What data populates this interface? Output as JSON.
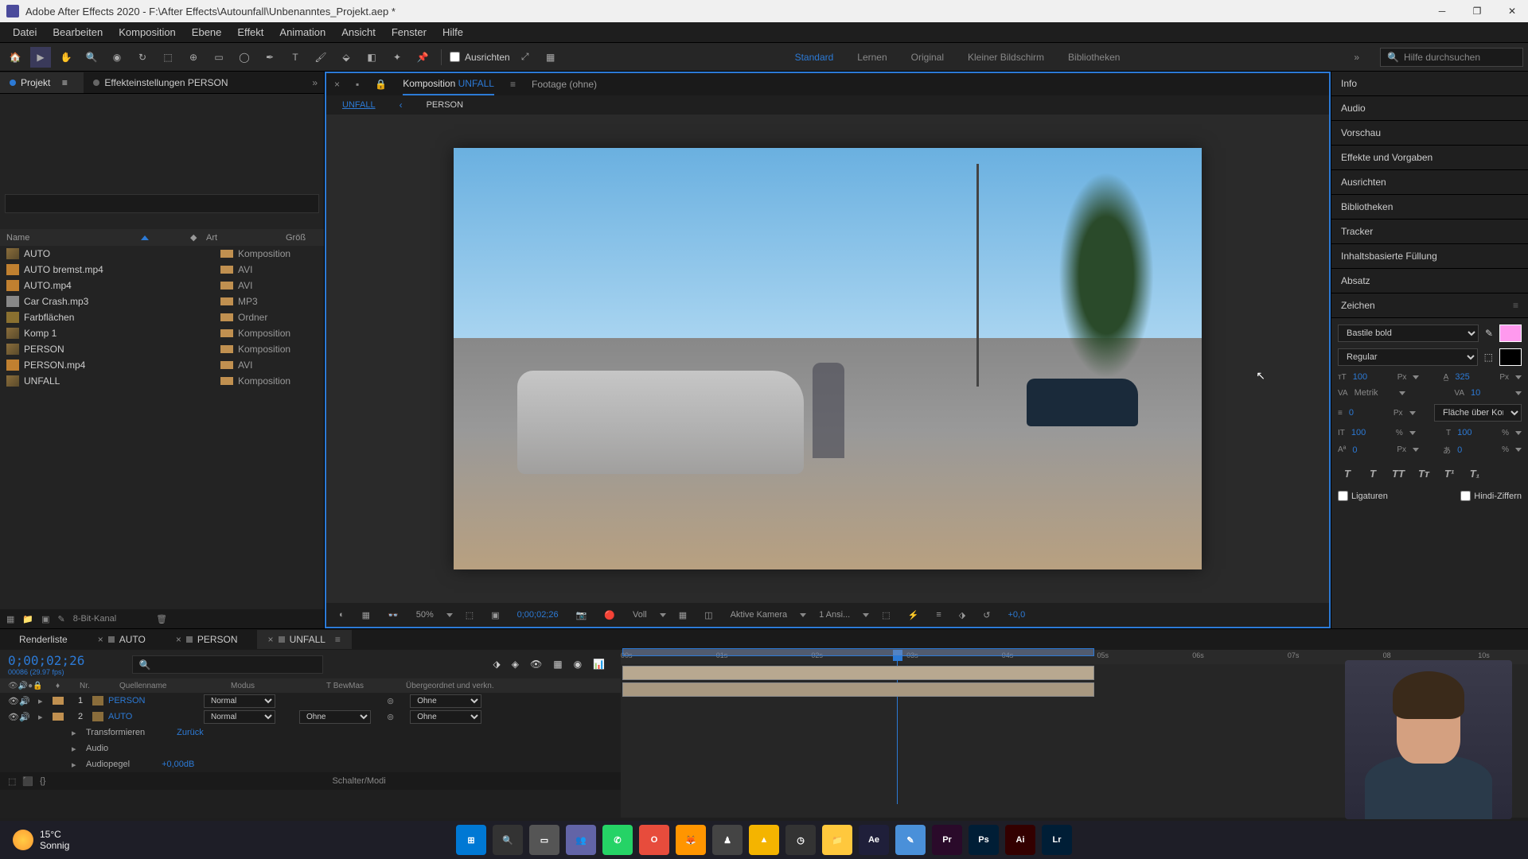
{
  "title_bar": {
    "text": "Adobe After Effects 2020 - F:\\After Effects\\Autounfall\\Unbenanntes_Projekt.aep *"
  },
  "menu": [
    "Datei",
    "Bearbeiten",
    "Komposition",
    "Ebene",
    "Effekt",
    "Animation",
    "Ansicht",
    "Fenster",
    "Hilfe"
  ],
  "toolbar": {
    "ausrichten": "Ausrichten",
    "workspaces": [
      "Standard",
      "Lernen",
      "Original",
      "Kleiner Bildschirm",
      "Bibliotheken"
    ],
    "active_workspace": "Standard",
    "search_placeholder": "Hilfe durchsuchen"
  },
  "project_panel": {
    "tabs": [
      {
        "label": "Projekt",
        "active": true
      },
      {
        "label": "Effekteinstellungen PERSON",
        "active": false
      }
    ],
    "search_placeholder": "",
    "columns": {
      "name": "Name",
      "art": "Art",
      "size": "Größ"
    },
    "items": [
      {
        "name": "AUTO",
        "type": "Komposition",
        "icon": "comp"
      },
      {
        "name": "AUTO bremst.mp4",
        "type": "AVI",
        "icon": "avi"
      },
      {
        "name": "AUTO.mp4",
        "type": "AVI",
        "icon": "avi"
      },
      {
        "name": "Car Crash.mp3",
        "type": "MP3",
        "icon": "mp3"
      },
      {
        "name": "Farbflächen",
        "type": "Ordner",
        "icon": "folder"
      },
      {
        "name": "Komp 1",
        "type": "Komposition",
        "icon": "comp"
      },
      {
        "name": "PERSON",
        "type": "Komposition",
        "icon": "comp"
      },
      {
        "name": "PERSON.mp4",
        "type": "AVI",
        "icon": "avi"
      },
      {
        "name": "UNFALL",
        "type": "Komposition",
        "icon": "comp"
      }
    ],
    "footer": {
      "bit": "8-Bit-Kanal"
    }
  },
  "viewer": {
    "tab_prefix": "Komposition",
    "tab_name": "UNFALL",
    "footage_tab": "Footage  (ohne)",
    "subtabs": [
      "UNFALL",
      "PERSON"
    ],
    "active_subtab": "UNFALL",
    "controls": {
      "zoom": "50%",
      "time": "0;00;02;26",
      "res": "Voll",
      "camera": "Aktive Kamera",
      "views": "1 Ansi...",
      "exposure": "+0,0"
    }
  },
  "right_panels": {
    "headers": [
      "Info",
      "Audio",
      "Vorschau",
      "Effekte und Vorgaben",
      "Ausrichten",
      "Bibliotheken",
      "Tracker",
      "Inhaltsbasierte Füllung",
      "Absatz",
      "Zeichen"
    ],
    "character": {
      "font": "Bastile bold",
      "style": "Regular",
      "size": "100",
      "leading": "325",
      "kerning": "Metrik",
      "tracking": "10",
      "stroke": "0",
      "stroke_label": "Fläche über Kon...",
      "vscale": "100",
      "hscale": "100",
      "baseline": "0",
      "tsume": "0",
      "px": "Px",
      "pct": "%",
      "ligatures": "Ligaturen",
      "hindi": "Hindi-Ziffern"
    }
  },
  "timeline": {
    "tabs": [
      {
        "label": "Renderliste",
        "active": false
      },
      {
        "label": "AUTO",
        "active": false
      },
      {
        "label": "PERSON",
        "active": false
      },
      {
        "label": "UNFALL",
        "active": true
      }
    ],
    "timecode": "0;00;02;26",
    "timecode_sub": "00086 (29.97 fps)",
    "columns": {
      "nr": "Nr.",
      "name": "Quellenname",
      "mode": "Modus",
      "trk": "T  BewMas",
      "parent": "Übergeordnet und verkn."
    },
    "layers": [
      {
        "nr": "1",
        "name": "PERSON",
        "mode": "Normal",
        "trk": "",
        "parent": "Ohne"
      },
      {
        "nr": "2",
        "name": "AUTO",
        "mode": "Normal",
        "trk": "Ohne",
        "parent": "Ohne"
      }
    ],
    "sublayers": [
      {
        "label": "Transformieren",
        "value": "Zurück"
      },
      {
        "label": "Audio",
        "value": ""
      },
      {
        "label": "Audiopegel",
        "value": "+0,00dB"
      }
    ],
    "ruler": [
      "00s",
      "01s",
      "02s",
      "03s",
      "04s",
      "05s",
      "06s",
      "07s",
      "08",
      "10s"
    ],
    "footer": "Schalter/Modi"
  },
  "weather": {
    "temp": "15°C",
    "cond": "Sonnig"
  },
  "taskbar_apps": [
    {
      "bg": "#0078d4",
      "txt": "⊞"
    },
    {
      "bg": "#333",
      "txt": "🔍"
    },
    {
      "bg": "#555",
      "txt": "▭"
    },
    {
      "bg": "#6264a7",
      "txt": "👥"
    },
    {
      "bg": "#25d366",
      "txt": "✆"
    },
    {
      "bg": "#e74c3c",
      "txt": "O"
    },
    {
      "bg": "#ff9500",
      "txt": "🦊"
    },
    {
      "bg": "#444",
      "txt": "♟"
    },
    {
      "bg": "#f4b400",
      "txt": "▲"
    },
    {
      "bg": "#333",
      "txt": "◷"
    },
    {
      "bg": "#ffc83d",
      "txt": "📁"
    },
    {
      "bg": "#1f1f3a",
      "txt": "Ae"
    },
    {
      "bg": "#4a90d9",
      "txt": "✎"
    },
    {
      "bg": "#2a0a2a",
      "txt": "Pr"
    },
    {
      "bg": "#001e36",
      "txt": "Ps"
    },
    {
      "bg": "#330000",
      "txt": "Ai"
    },
    {
      "bg": "#001e36",
      "txt": "Lr"
    }
  ]
}
